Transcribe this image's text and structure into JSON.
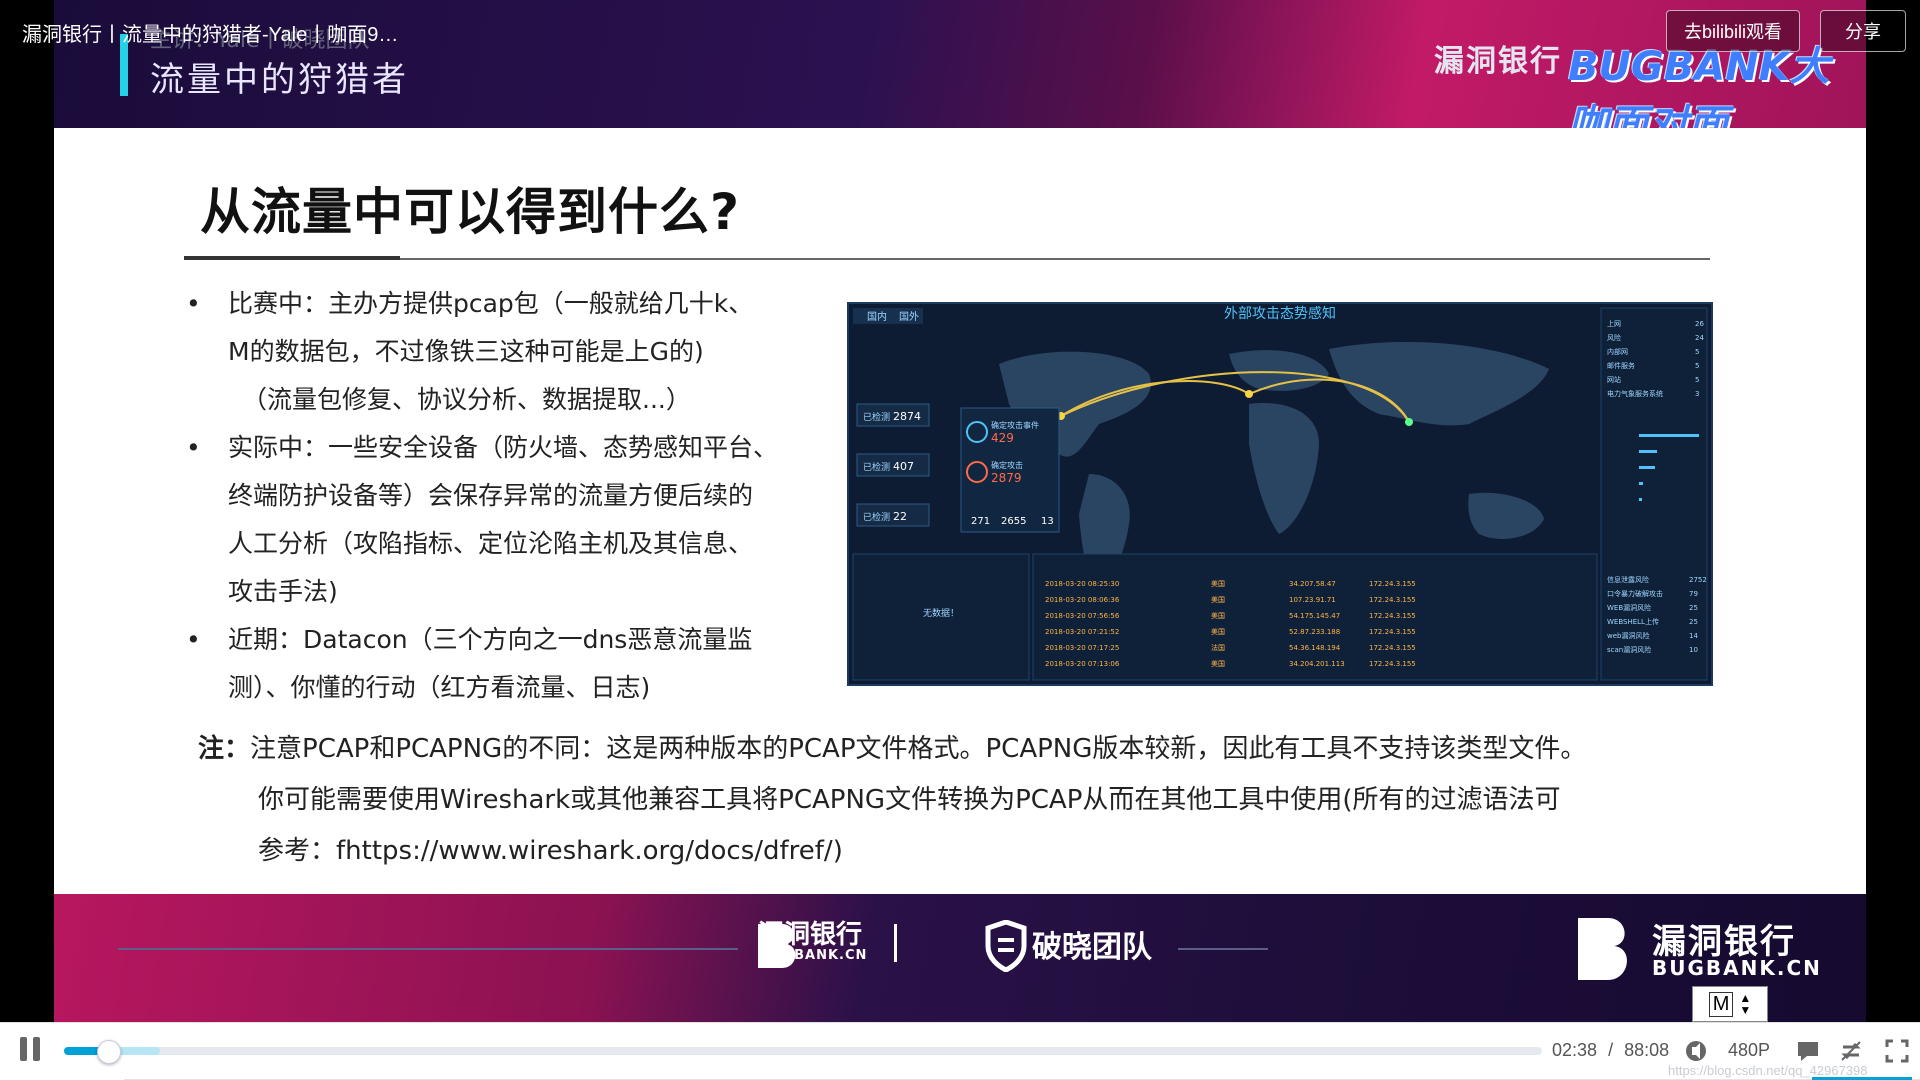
{
  "video": {
    "title": "漏洞银行丨流量中的狩猎者-Yale丨咖面9…",
    "goto_bilibili": "去bilibili观看",
    "share": "分享"
  },
  "banner": {
    "speaker": "主讲：Yale丨破晓团队",
    "talk_title": "流量中的狩猎者",
    "brand_cn": "漏洞银行",
    "brand_en": "BUGBANK大咖面对面"
  },
  "slide": {
    "title": "从流量中可以得到什么?",
    "bullets": [
      {
        "dot": "•",
        "lines": [
          "比赛中：主办方提供pcap包（一般就给几十k、",
          "M的数据包，不过像铁三这种可能是上G的)",
          "（流量包修复、协议分析、数据提取...）"
        ]
      },
      {
        "dot": "•",
        "lines": [
          "实际中：一些安全设备（防火墙、态势感知平台、",
          "终端防护设备等）会保存异常的流量方便后续的",
          "人工分析（攻陷指标、定位沦陷主机及其信息、",
          "攻击手法)"
        ]
      },
      {
        "dot": "•",
        "lines": [
          "近期：Datacon（三个方向之一dns恶意流量监",
          "测）、你懂的行动（红方看流量、日志)"
        ]
      }
    ],
    "note_label": "注：",
    "note_lines": [
      "注意PCAP和PCAPNG的不同：这是两种版本的PCAP文件格式。PCAPNG版本较新，因此有工具不支持该类型文件。",
      "你可能需要使用Wireshark或其他兼容工具将PCAPNG文件转换为PCAP从而在其他工具中使用(所有的过滤语法可",
      "参考：fhttps://www.wireshark.org/docs/dfref/)"
    ],
    "dashboard": {
      "title": "外部攻击态势感知",
      "tabs": [
        "国内",
        "国外"
      ],
      "stats": [
        {
          "label": "已检测",
          "value": "2874"
        },
        {
          "label": "已检测",
          "value": "407"
        },
        {
          "label": "已检测",
          "value": "22"
        }
      ],
      "alerts": [
        {
          "label": "确定攻击事件",
          "value": "429"
        },
        {
          "label": "确定攻击",
          "value": "2879"
        }
      ],
      "summary": [
        "271",
        "2655",
        "13"
      ],
      "no_data": "无数据！",
      "rows": [
        {
          "time": "2018-03-20 08:25:30",
          "country": "美国",
          "ip": "34.207.58.47",
          "dst": "172.24.3.155"
        },
        {
          "time": "2018-03-20 08:06:36",
          "country": "美国",
          "ip": "107.23.91.71",
          "dst": "172.24.3.155"
        },
        {
          "time": "2018-03-20 07:56:56",
          "country": "美国",
          "ip": "54.175.145.47",
          "dst": "172.24.3.155"
        },
        {
          "time": "2018-03-20 07:21:52",
          "country": "美国",
          "ip": "52.87.233.188",
          "dst": "172.24.3.155"
        },
        {
          "time": "2018-03-20 07:17:25",
          "country": "法国",
          "ip": "54.36.148.194",
          "dst": "172.24.3.155"
        },
        {
          "time": "2018-03-20 07:13:06",
          "country": "美国",
          "ip": "34.204.201.113",
          "dst": "172.24.3.155"
        }
      ],
      "right_list": [
        {
          "name": "上网",
          "n": "26"
        },
        {
          "name": "风险",
          "n": "24"
        },
        {
          "name": "内部网",
          "n": "5"
        },
        {
          "name": "邮件服务",
          "n": "5"
        },
        {
          "name": "网站",
          "n": "5"
        },
        {
          "name": "电力气象服务系统",
          "n": "3"
        }
      ],
      "right_bottom": [
        {
          "name": "信息泄露风险",
          "n": "2752"
        },
        {
          "name": "口令暴力破解攻击",
          "n": "79"
        },
        {
          "name": "WEB漏洞风险",
          "n": "25"
        },
        {
          "name": "WEBSHELL上传",
          "n": "25"
        },
        {
          "name": "web漏洞风险",
          "n": "14"
        },
        {
          "name": "scan漏洞风险",
          "n": "10"
        }
      ]
    }
  },
  "footer": {
    "brand1_cn": "漏洞银行",
    "brand1_en": "BUGBANK.CN",
    "separator": "|",
    "brand2_cn": "破晓团队",
    "brand3_cn": "漏洞银行",
    "brand3_en": "BUGBANK.CN",
    "quality_badge": "M"
  },
  "controls": {
    "current_time": "02:38",
    "sep": "/",
    "total_time": "88:08",
    "quality": "480P",
    "progress_fraction": 0.03,
    "buffered_fraction": 0.065,
    "watermark": "https://blog.csdn.net/qq_42967398"
  },
  "colors": {
    "accent": "#00a1d6",
    "banner_pink": "#c21a67",
    "banner_navy": "#1d0e3a"
  }
}
